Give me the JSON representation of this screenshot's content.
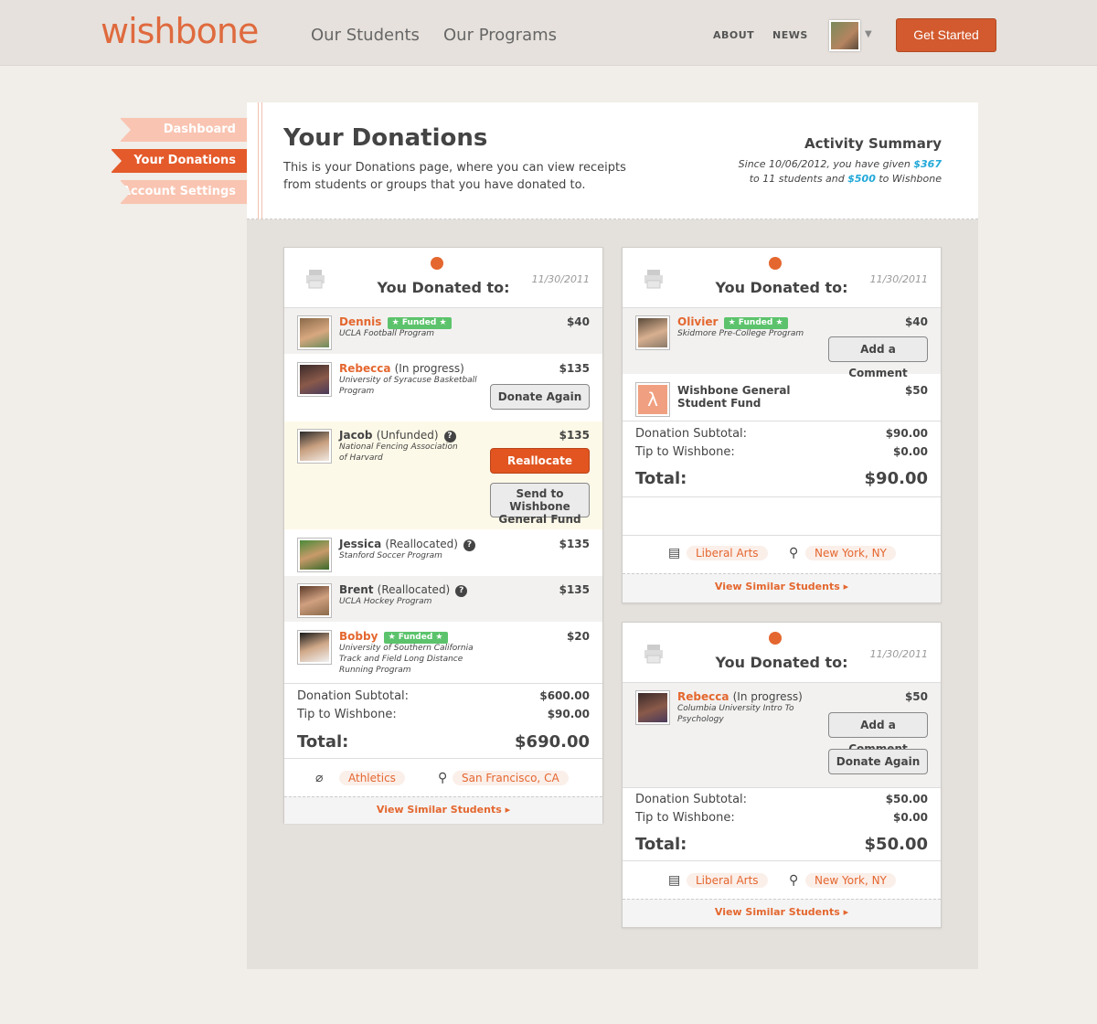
{
  "header": {
    "logo": "wishbone",
    "nav": [
      "Our Students",
      "Our Programs"
    ],
    "nav_small": [
      "ABOUT",
      "NEWS"
    ],
    "cta": "Get Started",
    "caret": "▼"
  },
  "sidebar": {
    "items": [
      "Dashboard",
      "Your Donations",
      "Account Settings"
    ]
  },
  "page": {
    "title": "Your Donations",
    "desc": "This is your Donations page, where you can view receipts from students or groups that you have donated to.",
    "activity_title": "Activity Summary",
    "activity_pre": "Since 10/06/2012, you have given ",
    "activity_amt1": "$367",
    "activity_mid": " to 11 students and ",
    "activity_amt2": "$500",
    "activity_post": " to Wishbone"
  },
  "card1": {
    "date": "11/30/2011",
    "title": "You Donated to:",
    "rows": [
      {
        "name": "Dennis",
        "status": "",
        "funded": "★ Funded ★",
        "program": "UCLA Football Program",
        "amount": "$40"
      },
      {
        "name": "Rebecca",
        "status": "(In progress)",
        "program": "University of Syracuse Basketball Program",
        "amount": "$135",
        "button": "Donate Again"
      },
      {
        "name": "Jacob",
        "status": "(Unfunded)",
        "program": "National Fencing Association of Harvard",
        "amount": "$135",
        "button1": "Reallocate",
        "button2a": "Send to Wishbone",
        "button2b": "General Fund"
      },
      {
        "name": "Jessica",
        "status": "(Reallocated)",
        "program": "Stanford Soccer Program",
        "amount": "$135"
      },
      {
        "name": "Brent",
        "status": "(Reallocated)",
        "program": "UCLA Hockey Program",
        "amount": "$135"
      },
      {
        "name": "Bobby",
        "status": "",
        "funded": "★ Funded ★",
        "program": "University of Southern California Track and Field Long Distance Running Program",
        "amount": "$20"
      }
    ],
    "subtotal_label": "Donation Subtotal:",
    "subtotal": "$600.00",
    "tip_label": "Tip to Wishbone:",
    "tip": "$90.00",
    "total_label": "Total:",
    "total": "$690.00",
    "tag1": "Athletics",
    "tag2": "San Francisco, CA",
    "link": "View Similar Students ▸"
  },
  "card2": {
    "date": "11/30/2011",
    "title": "You Donated to:",
    "rows": [
      {
        "name": "Olivier",
        "funded": "★ Funded ★",
        "program": "Skidmore Pre-College Program",
        "amount": "$40",
        "button": "Add a Comment"
      },
      {
        "name_a": "Wishbone General",
        "name_b": "Student Fund",
        "amount": "$50"
      }
    ],
    "subtotal_label": "Donation Subtotal:",
    "subtotal": "$90.00",
    "tip_label": "Tip to Wishbone:",
    "tip": "$0.00",
    "total_label": "Total:",
    "total": "$90.00",
    "tag1": "Liberal Arts",
    "tag2": "New York, NY",
    "link": "View Similar Students ▸"
  },
  "card3": {
    "date": "11/30/2011",
    "title": "You Donated to:",
    "rows": [
      {
        "name": "Rebecca",
        "status": "(In progress)",
        "program": "Columbia University Intro To Psychology",
        "amount": "$50",
        "button1": "Add a Comment",
        "button2": "Donate Again"
      }
    ],
    "subtotal_label": "Donation Subtotal:",
    "subtotal": "$50.00",
    "tip_label": "Tip to Wishbone:",
    "tip": "$0.00",
    "total_label": "Total:",
    "total": "$50.00",
    "tag1": "Liberal Arts",
    "tag2": "New York, NY",
    "link": "View Similar Students ▸"
  },
  "colors": {
    "accent": "#e4672f",
    "funded": "#5cc36c",
    "link": "#21a8d8"
  }
}
